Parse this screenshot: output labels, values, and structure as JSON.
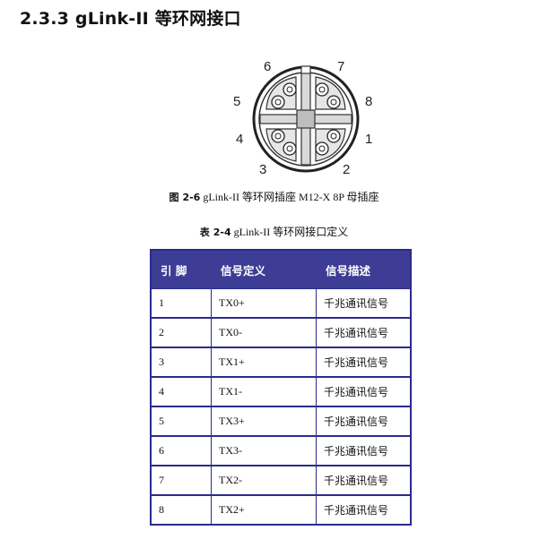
{
  "heading": "2.3.3 gLink-II 等环网接口",
  "connector": {
    "pin_labels": [
      "6",
      "7",
      "5",
      "8",
      "4",
      "1",
      "3",
      "2"
    ]
  },
  "figure_caption": {
    "prefix": "图",
    "number": "2-6",
    "text": "gLink-II 等环网插座 M12-X 8P  母插座"
  },
  "table_caption": {
    "prefix": "表",
    "number": "2-4",
    "text": "gLink-II 等环网接口定义"
  },
  "table": {
    "headers": [
      "引  脚",
      "信号定义",
      "信号描述"
    ],
    "rows": [
      {
        "pin": "1",
        "signal": "TX0+",
        "desc": "千兆通讯信号"
      },
      {
        "pin": "2",
        "signal": "TX0-",
        "desc": "千兆通讯信号"
      },
      {
        "pin": "3",
        "signal": "TX1+",
        "desc": "千兆通讯信号"
      },
      {
        "pin": "4",
        "signal": "TX1-",
        "desc": "千兆通讯信号"
      },
      {
        "pin": "5",
        "signal": "TX3+",
        "desc": "千兆通讯信号"
      },
      {
        "pin": "6",
        "signal": "TX3-",
        "desc": "千兆通讯信号"
      },
      {
        "pin": "7",
        "signal": "TX2-",
        "desc": "千兆通讯信号"
      },
      {
        "pin": "8",
        "signal": "TX2+",
        "desc": "千兆通讯信号"
      }
    ]
  }
}
